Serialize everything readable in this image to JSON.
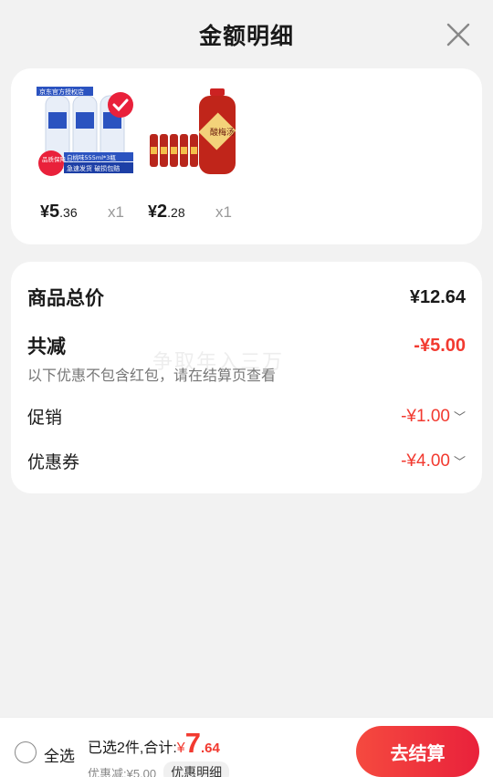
{
  "header": {
    "title": "金额明细"
  },
  "products": [
    {
      "name_badge": "京东官方授权店",
      "tag_line": "白桃味555ml*3瓶",
      "quality_badge": "品质保障",
      "promo_line": "急速发货 破损包赔",
      "price_yen": "¥",
      "price_int": "5",
      "price_dec": ".36",
      "qty": "x1"
    },
    {
      "label_text": "酸梅汤",
      "price_yen": "¥",
      "price_int": "2",
      "price_dec": ".28",
      "qty": "x1"
    }
  ],
  "summary": {
    "total_label": "商品总价",
    "total_value": "¥12.64",
    "reduce_label": "共减",
    "reduce_value": "-¥5.00",
    "note": "以下优惠不包含红包，请在结算页查看",
    "watermark": "争取年入三万",
    "promo_label": "促销",
    "promo_value": "-¥1.00",
    "coupon_label": "优惠券",
    "coupon_value": "-¥4.00"
  },
  "footer": {
    "select_all": "全选",
    "selected_text": "已选2件,合计:",
    "total_yen": "¥",
    "total_int": "7",
    "total_dec": ".64",
    "discount_text": "优惠减:¥5.00",
    "detail_tag": "优惠明细",
    "checkout": "去结算"
  },
  "colors": {
    "accent": "#f23a30",
    "button_start": "#f54a3f",
    "button_end": "#e9213b",
    "background": "#f2f2f2"
  }
}
